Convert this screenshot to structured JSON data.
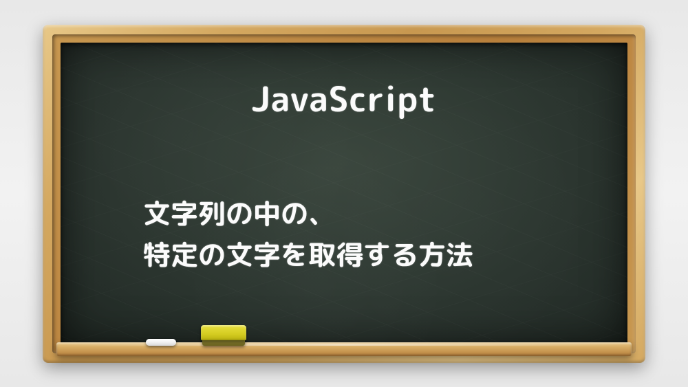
{
  "board": {
    "title": "JavaScript",
    "subtitle": "文字列の中の、\n特定の文字を取得する方法"
  }
}
